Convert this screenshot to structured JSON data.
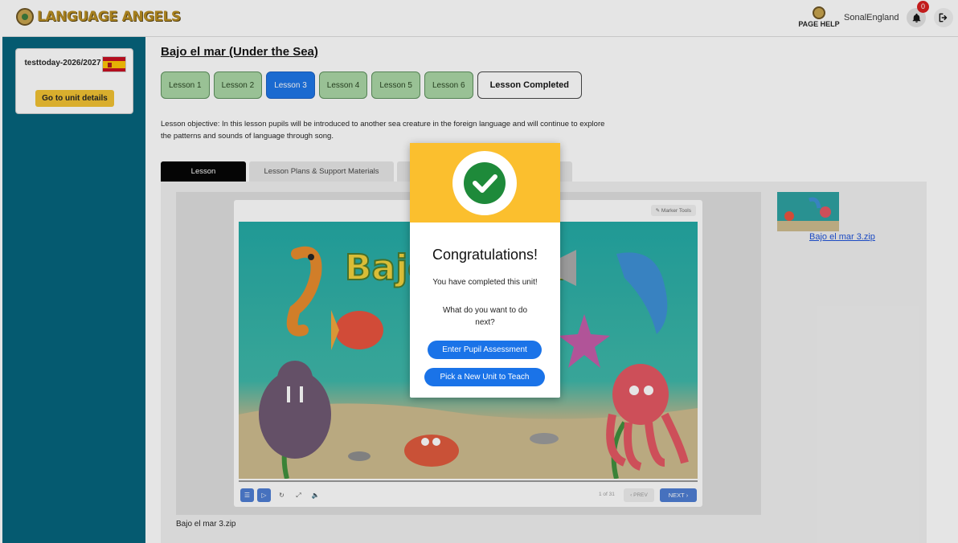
{
  "header": {
    "logo_text": "LANGUAGE ANGELS",
    "page_help_label": "PAGE HELP",
    "user_name": "SonalEngland",
    "notification_count": "0",
    "logout_glyph": "⇥"
  },
  "sidebar": {
    "class_name": "testtoday-2026/2027",
    "flag": "spain-flag",
    "unit_details_button": "Go to unit details"
  },
  "main": {
    "unit_title": "Bajo el mar (Under the Sea)",
    "lesson_tabs": [
      {
        "label": "Lesson 1",
        "state": "default"
      },
      {
        "label": "Lesson 2",
        "state": "default"
      },
      {
        "label": "Lesson 3",
        "state": "active"
      },
      {
        "label": "Lesson 4",
        "state": "default"
      },
      {
        "label": "Lesson 5",
        "state": "default"
      },
      {
        "label": "Lesson 6",
        "state": "default"
      },
      {
        "label": "Lesson Completed",
        "state": "completed"
      }
    ],
    "objective": "Lesson objective: In this lesson pupils will be introduced to another sea creature in the foreign language and will continue to explore the patterns and sounds of language through song.",
    "content_tabs": [
      "Lesson",
      "Lesson Plans & Support Materials",
      ""
    ],
    "viewer": {
      "marker_tools_label": "Marker Tools",
      "slide_title": "Bajo el mar",
      "page_counter": "1 of 31",
      "prev_label": "PREV",
      "next_label": "NEXT"
    },
    "file_caption": "Bajo el mar 3.zip",
    "thumbnail_link": "Bajo el mar 3.zip"
  },
  "modal": {
    "title": "Congratulations!",
    "message": "You have completed this unit!",
    "question": "What do you want to do next?",
    "primary_button": "Enter Pupil Assessment",
    "secondary_button": "Pick a New Unit to Teach",
    "accent_color": "#fbbf2e",
    "check_color": "#1e8a3a"
  },
  "colors": {
    "sidebar": "#00617a",
    "lesson_tab": "#a9d6a4",
    "lesson_tab_active": "#1a73e8",
    "button_blue": "#1a73e8"
  }
}
